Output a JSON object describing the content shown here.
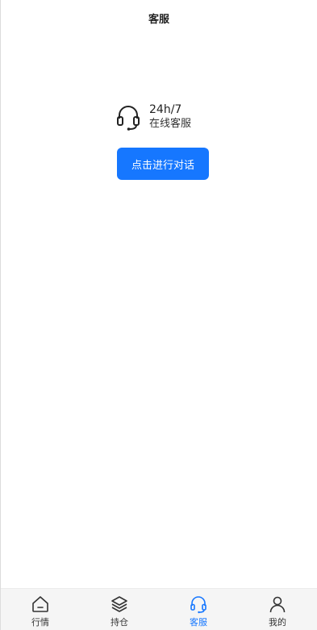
{
  "header": {
    "title": "客服"
  },
  "service": {
    "hours": "24h/7",
    "label": "在线客服"
  },
  "chat_button": {
    "label": "点击进行对话"
  },
  "tabbar": {
    "active": "客服",
    "tabs": [
      {
        "label": "行情",
        "icon": "home-icon"
      },
      {
        "label": "持仓",
        "icon": "layers-icon"
      },
      {
        "label": "客服",
        "icon": "headset-icon"
      },
      {
        "label": "我的",
        "icon": "user-icon"
      }
    ]
  },
  "colors": {
    "accent": "#1677ff",
    "tabbar_bg": "#f5f5f5"
  }
}
